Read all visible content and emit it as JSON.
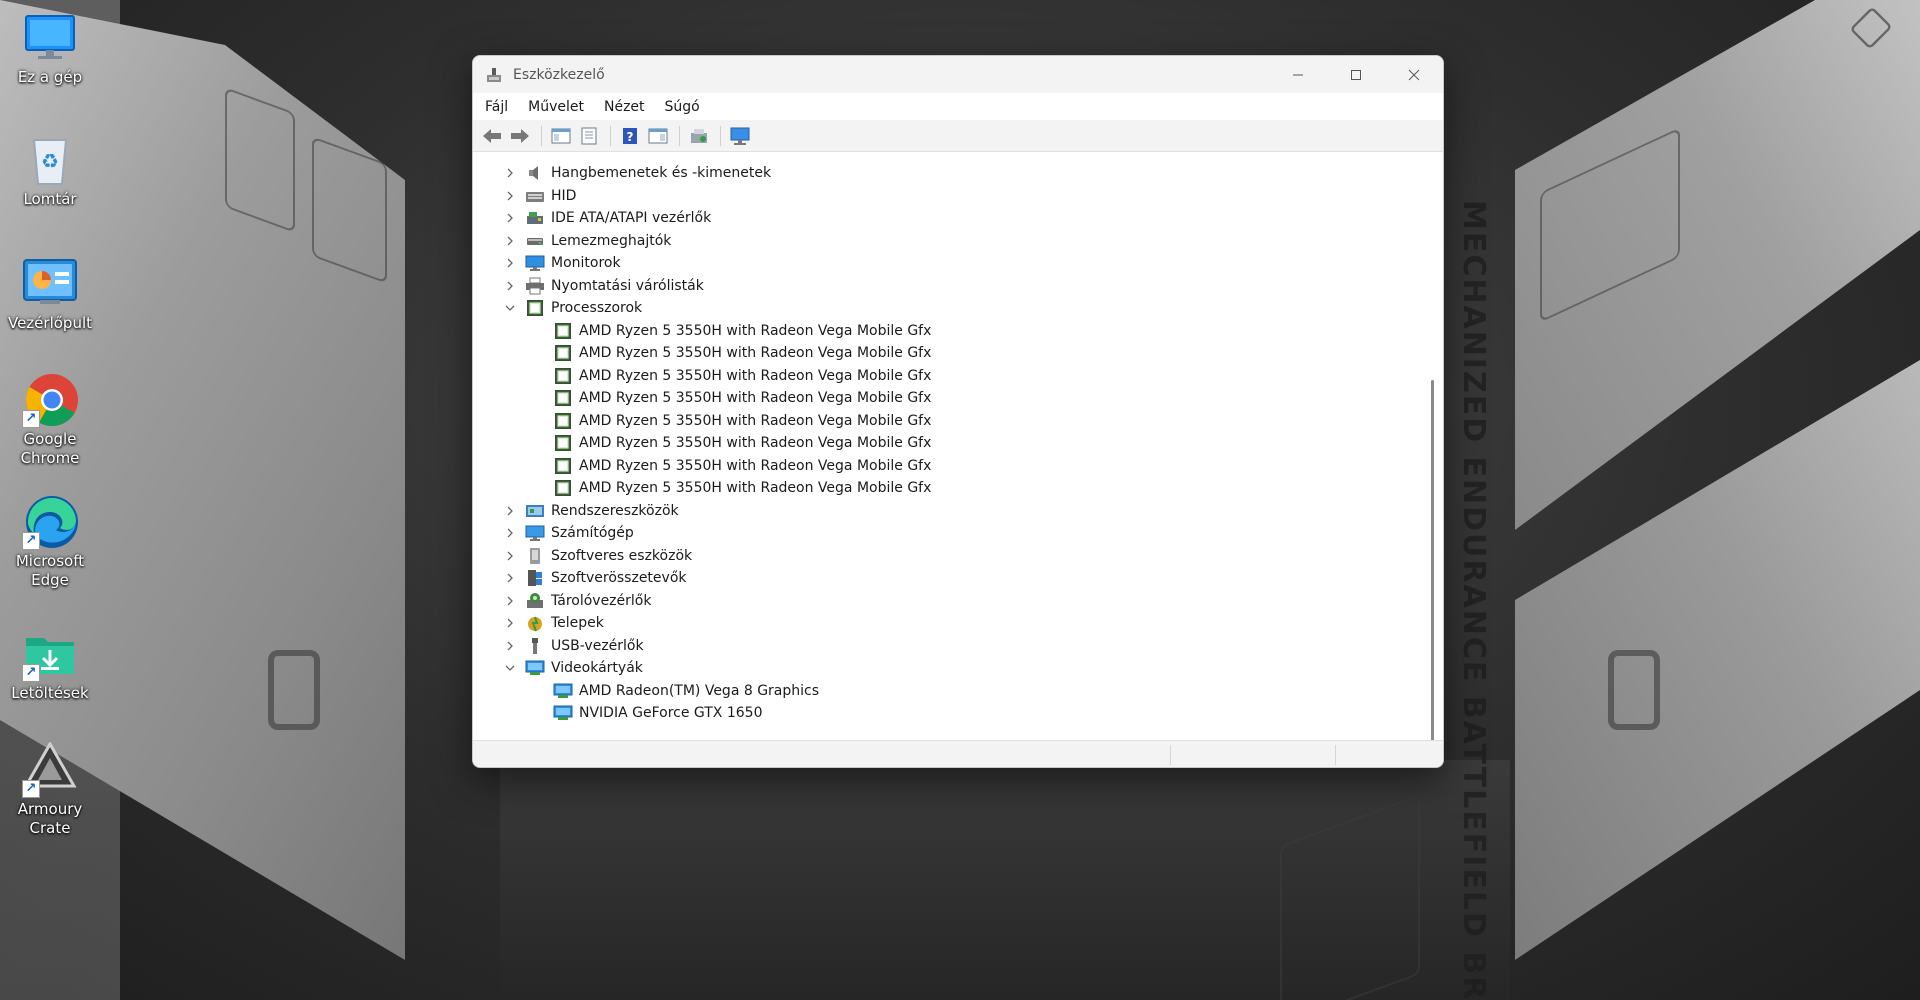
{
  "desktop": {
    "icons": [
      {
        "label": "Ez a gép",
        "icon": "monitor-icon"
      },
      {
        "label": "Lomtár",
        "icon": "recycle-bin-icon"
      },
      {
        "label": "Vezérlőpult",
        "icon": "control-panel-icon"
      },
      {
        "label": "Google Chrome",
        "icon": "chrome-icon"
      },
      {
        "label": "Microsoft Edge",
        "icon": "edge-icon"
      },
      {
        "label": "Letöltések",
        "icon": "downloads-folder-icon"
      },
      {
        "label": "Armoury Crate",
        "icon": "armoury-crate-icon"
      }
    ],
    "wallpaper_text": "MECHANIZED ENDURANCE BATTLEFIELD BRILLIANCE"
  },
  "window": {
    "title": "Eszközkezelő",
    "menu": [
      "Fájl",
      "Művelet",
      "Nézet",
      "Súgó"
    ],
    "toolbar": [
      "back-icon",
      "forward-icon",
      "show-hide-console-tree-icon",
      "properties-icon",
      "help-icon",
      "action-pane-icon",
      "update-driver-icon",
      "scan-hardware-icon"
    ],
    "tree": {
      "categories": [
        {
          "label": "Hangbemenetek és -kimenetek",
          "icon": "speaker-icon",
          "expanded": false
        },
        {
          "label": "HID",
          "icon": "hid-icon",
          "expanded": false
        },
        {
          "label": "IDE ATA/ATAPI vezérlők",
          "icon": "ide-controller-icon",
          "expanded": false
        },
        {
          "label": "Lemezmeghajtók",
          "icon": "disk-drive-icon",
          "expanded": false
        },
        {
          "label": "Monitorok",
          "icon": "monitor-icon",
          "expanded": false
        },
        {
          "label": "Nyomtatási várólisták",
          "icon": "printer-icon",
          "expanded": false
        },
        {
          "label": "Processzorok",
          "icon": "processor-icon",
          "expanded": true,
          "children": [
            "AMD Ryzen 5 3550H with Radeon Vega Mobile Gfx",
            "AMD Ryzen 5 3550H with Radeon Vega Mobile Gfx",
            "AMD Ryzen 5 3550H with Radeon Vega Mobile Gfx",
            "AMD Ryzen 5 3550H with Radeon Vega Mobile Gfx",
            "AMD Ryzen 5 3550H with Radeon Vega Mobile Gfx",
            "AMD Ryzen 5 3550H with Radeon Vega Mobile Gfx",
            "AMD Ryzen 5 3550H with Radeon Vega Mobile Gfx",
            "AMD Ryzen 5 3550H with Radeon Vega Mobile Gfx"
          ]
        },
        {
          "label": "Rendszereszközök",
          "icon": "system-devices-icon",
          "expanded": false
        },
        {
          "label": "Számítógép",
          "icon": "computer-icon",
          "expanded": false
        },
        {
          "label": "Szoftveres eszközök",
          "icon": "software-device-icon",
          "expanded": false
        },
        {
          "label": "Szoftverösszetevők",
          "icon": "software-component-icon",
          "expanded": false
        },
        {
          "label": "Tárolóvezérlők",
          "icon": "storage-controller-icon",
          "expanded": false
        },
        {
          "label": "Telepek",
          "icon": "battery-icon",
          "expanded": false
        },
        {
          "label": "USB-vezérlők",
          "icon": "usb-icon",
          "expanded": false
        },
        {
          "label": "Videokártyák",
          "icon": "display-adapter-icon",
          "expanded": true,
          "children": [
            "AMD Radeon(TM) Vega 8 Graphics",
            "NVIDIA GeForce GTX 1650"
          ]
        }
      ]
    }
  },
  "colors": {
    "accent": "#0067c0",
    "window_bg": "#ffffff",
    "chrome_bg": "#f3f3f3"
  }
}
